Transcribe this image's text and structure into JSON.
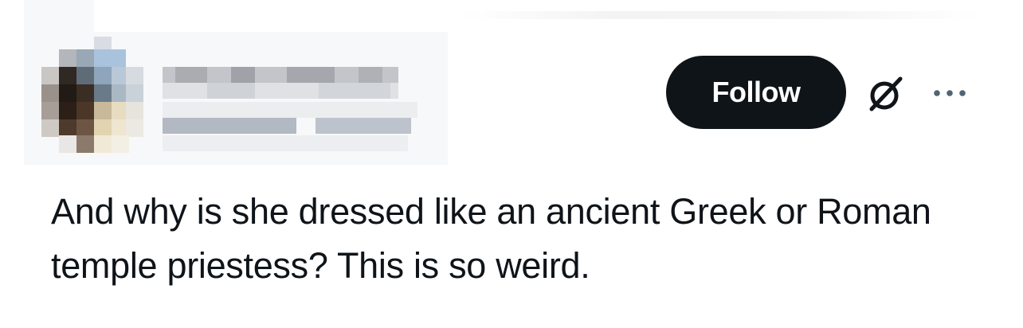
{
  "header": {
    "follow_label": "Follow",
    "grok_icon": "grok-slash-circle-icon",
    "more_icon": "more-horizontal-icon"
  },
  "author": {
    "avatar": "pixelated-avatar",
    "name_obscured": true
  },
  "post": {
    "text": "And why is she dressed like an ancient Greek or Roman temple priestess? This is so weird."
  },
  "colors": {
    "button_bg": "#0f1419",
    "button_text": "#ffffff",
    "text": "#0f1419",
    "icon": "#536471"
  }
}
